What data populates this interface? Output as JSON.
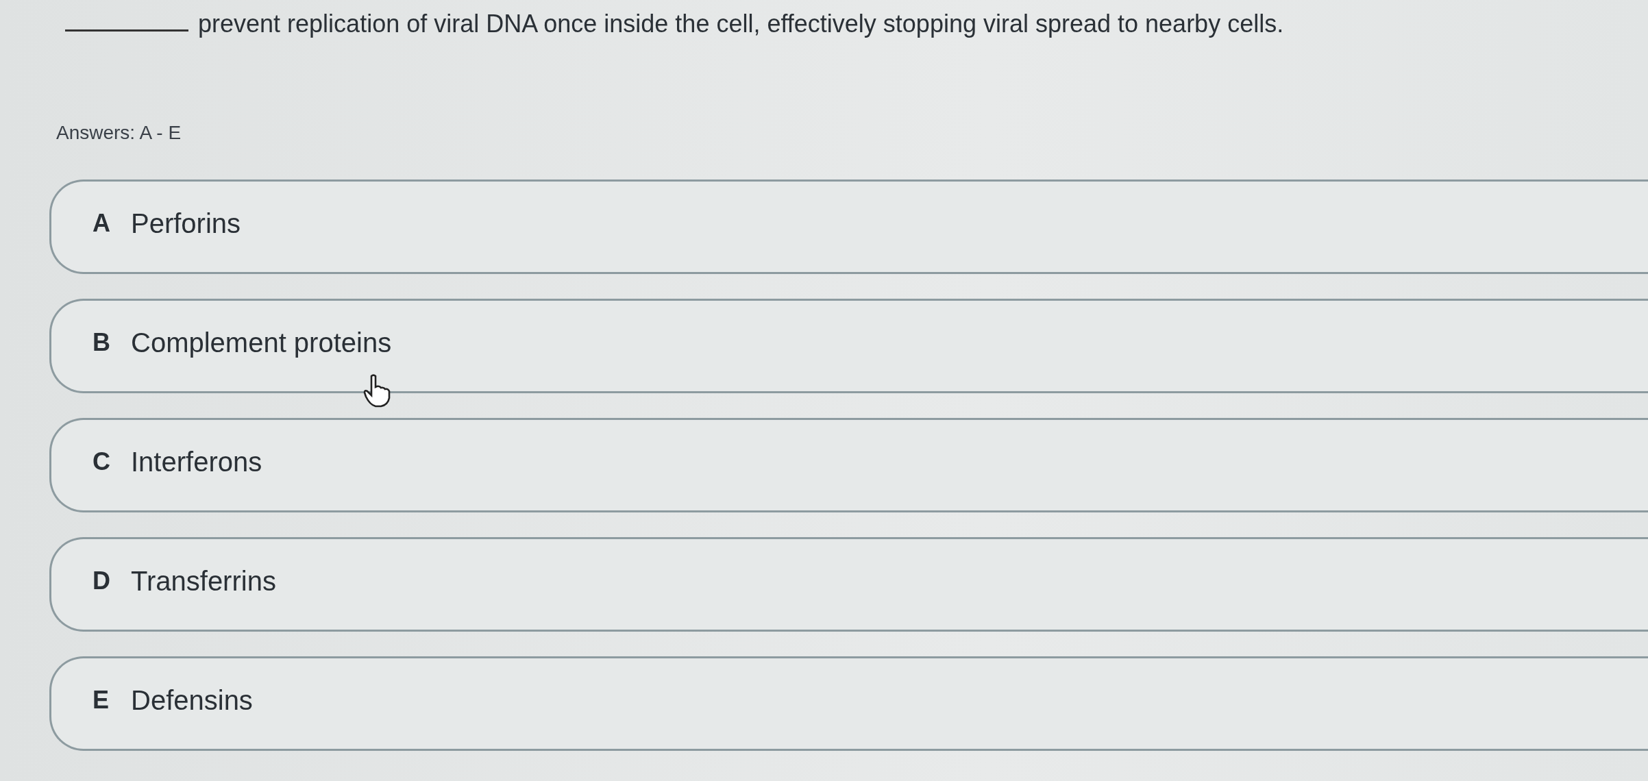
{
  "question": {
    "text": "prevent replication of viral DNA once inside the cell, effectively stopping viral spread to nearby cells."
  },
  "answers_label": "Answers: A - E",
  "options": [
    {
      "letter": "A",
      "text": "Perforins"
    },
    {
      "letter": "B",
      "text": "Complement proteins"
    },
    {
      "letter": "C",
      "text": "Interferons"
    },
    {
      "letter": "D",
      "text": "Transferrins"
    },
    {
      "letter": "E",
      "text": "Defensins"
    }
  ]
}
